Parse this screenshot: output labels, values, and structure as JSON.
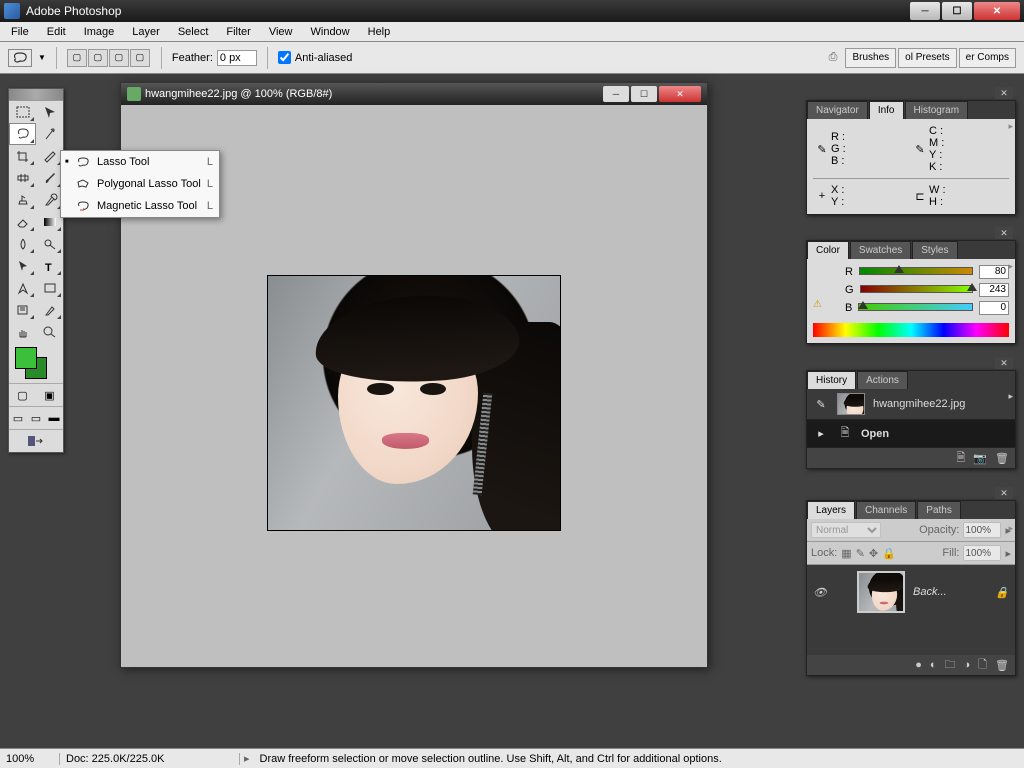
{
  "app": {
    "title": "Adobe Photoshop"
  },
  "menu": [
    "File",
    "Edit",
    "Image",
    "Layer",
    "Select",
    "Filter",
    "View",
    "Window",
    "Help"
  ],
  "options": {
    "feather_label": "Feather:",
    "feather_value": "0 px",
    "antialias_label": "Anti-aliased",
    "tabs": [
      "Brushes",
      "ol Presets",
      "er Comps"
    ]
  },
  "flyout": {
    "items": [
      {
        "label": "Lasso Tool",
        "shortcut": "L",
        "selected": true
      },
      {
        "label": "Polygonal Lasso Tool",
        "shortcut": "L",
        "selected": false
      },
      {
        "label": "Magnetic Lasso Tool",
        "shortcut": "L",
        "selected": false
      }
    ]
  },
  "tools": [
    "rect-marquee",
    "move",
    "lasso",
    "magic-wand",
    "crop",
    "slice",
    "healing",
    "brush",
    "clone",
    "history-brush",
    "eraser",
    "gradient",
    "blur",
    "dodge",
    "path-select",
    "type",
    "pen",
    "shape",
    "notes",
    "eyedropper",
    "hand",
    "zoom"
  ],
  "doc": {
    "title": "hwangmihee22.jpg @ 100% (RGB/8#)"
  },
  "panels": {
    "info": {
      "tabs": [
        "Navigator",
        "Info",
        "Histogram"
      ],
      "rgb": {
        "R": "R :",
        "G": "G :",
        "B": "B :"
      },
      "cmyk": {
        "C": "C :",
        "M": "M :",
        "Y": "Y :",
        "K": "K :"
      },
      "xy": {
        "X": "X :",
        "Y": "Y :"
      },
      "wh": {
        "W": "W :",
        "H": "H :"
      }
    },
    "color": {
      "tabs": [
        "Color",
        "Swatches",
        "Styles"
      ],
      "channels": [
        {
          "label": "R",
          "value": "80",
          "grad": "linear-gradient(to right,#000,#f00)",
          "pos": 31
        },
        {
          "label": "G",
          "value": "243",
          "grad": "linear-gradient(to right,#000,#0f0)",
          "pos": 95
        },
        {
          "label": "B",
          "value": "0",
          "grad": "linear-gradient(to right,#000,#00f)",
          "pos": 0
        }
      ],
      "fg": "#50f300",
      "bg": "#2a8a2a"
    },
    "history": {
      "tabs": [
        "History",
        "Actions"
      ],
      "snapshot": "hwangmihee22.jpg",
      "steps": [
        "Open"
      ]
    },
    "layers": {
      "tabs": [
        "Layers",
        "Channels",
        "Paths"
      ],
      "blend": "Normal",
      "opacity_label": "Opacity:",
      "opacity": "100%",
      "lock_label": "Lock:",
      "fill_label": "Fill:",
      "fill": "100%",
      "rows": [
        {
          "name": "Back..."
        }
      ]
    }
  },
  "status": {
    "zoom": "100%",
    "doc": "Doc: 225.0K/225.0K",
    "hint": "Draw freeform selection or move selection outline.  Use Shift, Alt, and Ctrl for additional options."
  }
}
